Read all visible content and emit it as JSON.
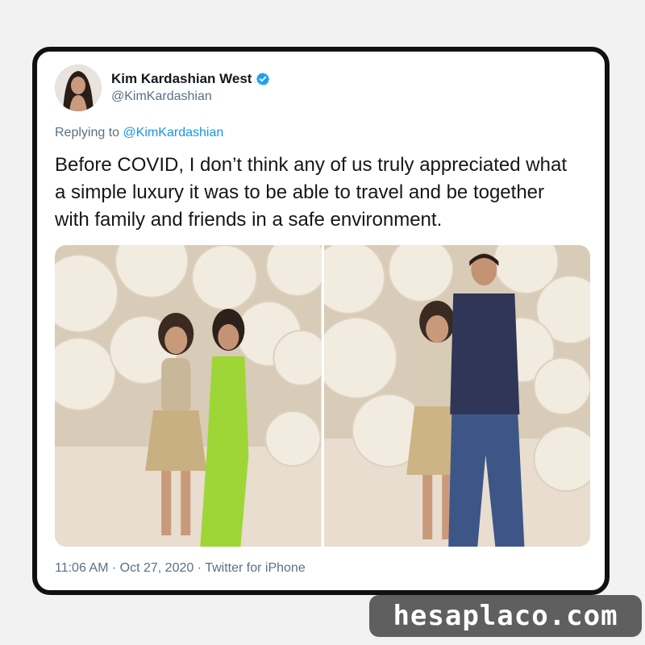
{
  "tweet": {
    "display_name": "Kim Kardashian West",
    "handle": "@KimKardashian",
    "verified_icon": "verified-badge-icon",
    "reply_prefix": "Replying to",
    "reply_to": "@KimKardashian",
    "text": "Before COVID, I don’t think any of us truly appreciated what a simple luxury it was to be able to travel and be together with family and friends in a safe environment.",
    "time": "11:06 AM",
    "date": "Oct 27, 2020",
    "source": "Twitter for iPhone",
    "separator": "·"
  },
  "media": {
    "count": 2
  },
  "watermark": {
    "text": "hesaplaco.com"
  },
  "colors": {
    "link": "#1b95e0",
    "verified": "#1da1f2",
    "text": "#14171a",
    "muted": "#5b7083",
    "card_border": "#111111",
    "watermark_bg": "#5f5f5f"
  }
}
